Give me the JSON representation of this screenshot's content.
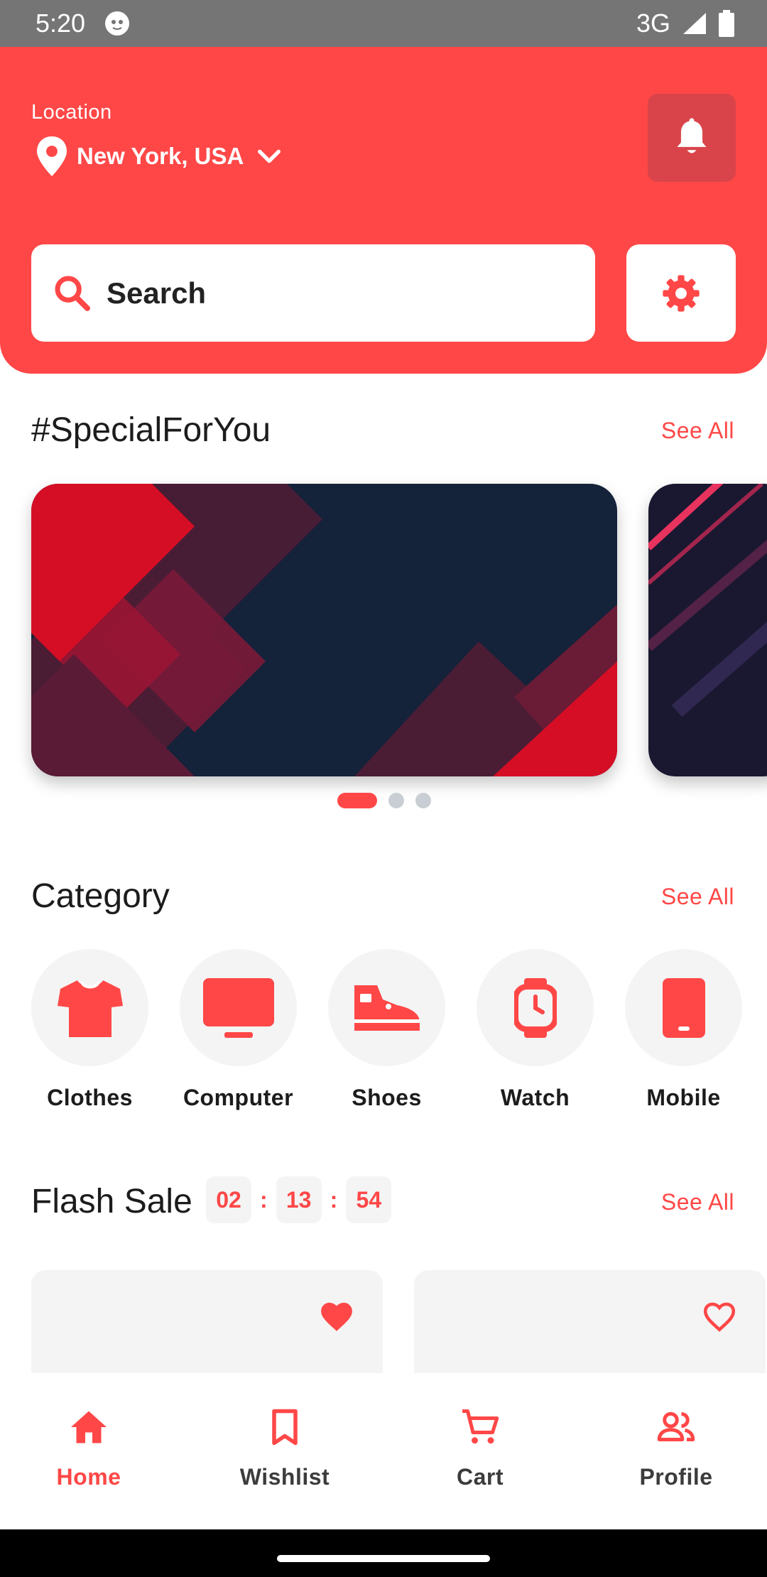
{
  "status_bar": {
    "time": "5:20",
    "network": "3G"
  },
  "header": {
    "location_label": "Location",
    "location_value": "New York, USA",
    "search_placeholder": "Search"
  },
  "special": {
    "title": "#SpecialForYou",
    "see_all": "See All",
    "carousel_pages": 3,
    "carousel_active": 1
  },
  "category": {
    "title": "Category",
    "see_all": "See All",
    "items": [
      {
        "label": "Clothes",
        "icon": "tshirt-icon"
      },
      {
        "label": "Computer",
        "icon": "monitor-icon"
      },
      {
        "label": "Shoes",
        "icon": "shoe-icon"
      },
      {
        "label": "Watch",
        "icon": "watch-icon"
      },
      {
        "label": "Mobile",
        "icon": "phone-icon"
      }
    ]
  },
  "flash_sale": {
    "title": "Flash Sale",
    "timer": {
      "hours": "02",
      "minutes": "13",
      "seconds": "54"
    },
    "see_all": "See All",
    "products": [
      {
        "favorited": true
      },
      {
        "favorited": false
      }
    ]
  },
  "bottom_nav": {
    "items": [
      {
        "label": "Home",
        "icon": "home-icon",
        "active": true
      },
      {
        "label": "Wishlist",
        "icon": "bookmark-icon",
        "active": false
      },
      {
        "label": "Cart",
        "icon": "cart-icon",
        "active": false
      },
      {
        "label": "Profile",
        "icon": "people-icon",
        "active": false
      }
    ]
  },
  "colors": {
    "accent": "#ff4747",
    "bell_button": "#d9444a",
    "banner_dark": "#14223a",
    "light_bg": "#f4f4f4"
  }
}
